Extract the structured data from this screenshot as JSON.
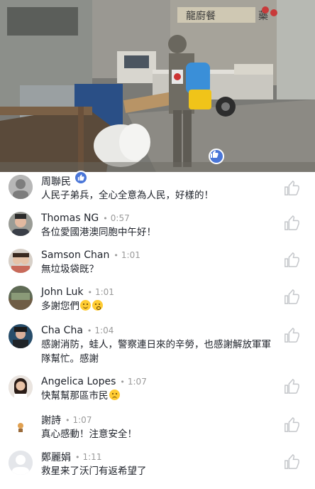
{
  "video": {
    "shop_sign_left": "龍廚餐",
    "shop_sign_right": "藥"
  },
  "comments": [
    {
      "name": "周聯民",
      "sep": "",
      "time": "",
      "text": "人民子弟兵，全心全意為人民，好樣的！",
      "emoji": ""
    },
    {
      "name": "Thomas NG",
      "sep": "•",
      "time": "0:57",
      "text": "各位愛國港澳同胞中午好！",
      "emoji": ""
    },
    {
      "name": "Samson Chan",
      "sep": "•",
      "time": "1:01",
      "text": "無垃圾袋既？",
      "emoji": ""
    },
    {
      "name": "John Luk",
      "sep": "•",
      "time": "1:01",
      "text": "多謝您們",
      "emoji": "😊😘"
    },
    {
      "name": "Cha Cha",
      "sep": "•",
      "time": "1:04",
      "text": "感謝消防，蛙人，警察連日來的辛勞，也感謝解放軍軍隊幫忙。感謝",
      "emoji": ""
    },
    {
      "name": "Angelica Lopes",
      "sep": "•",
      "time": "1:07",
      "text": "快幫幫那區市民",
      "emoji": "😥"
    },
    {
      "name": "謝詩",
      "sep": "•",
      "time": "1:07",
      "text": "真心感動！注意安全！",
      "emoji": ""
    },
    {
      "name": "鄭麗娟",
      "sep": "•",
      "time": "1:11",
      "text": "救星来了沃门有返希望了",
      "emoji": ""
    }
  ],
  "colors": {
    "link_blue": "#4a76d8",
    "text": "#1d2129",
    "meta": "#9a9a9a"
  },
  "icons": {
    "like": "thumbs-up-icon"
  }
}
